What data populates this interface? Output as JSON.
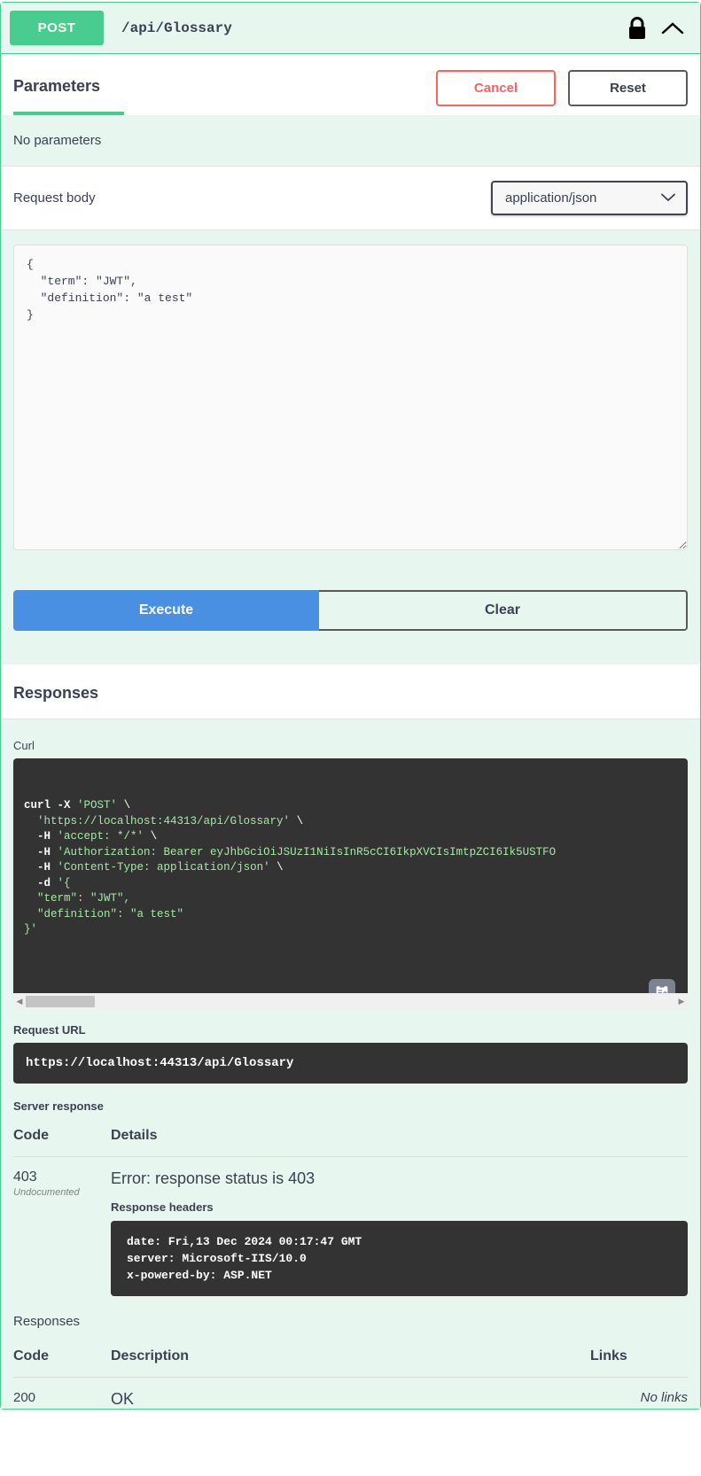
{
  "operation": {
    "method": "POST",
    "path": "/api/Glossary",
    "lock_icon": "lock-icon",
    "collapse_icon": "chevron-up-icon"
  },
  "parameters": {
    "title": "Parameters",
    "cancel_label": "Cancel",
    "reset_label": "Reset",
    "empty_text": "No parameters"
  },
  "request_body": {
    "label": "Request body",
    "content_type": "application/json",
    "content_type_options": [
      "application/json"
    ],
    "dropdown_icon": "chevron-down-icon",
    "editor_value": "{\n  \"term\": \"JWT\",\n  \"definition\": \"a test\"\n}"
  },
  "actions": {
    "execute_label": "Execute",
    "clear_label": "Clear"
  },
  "responses_section": {
    "title": "Responses",
    "curl_label": "Curl",
    "curl_lines": [
      "curl -X 'POST' \\",
      "  'https://localhost:44313/api/Glossary' \\",
      "  -H 'accept: */*' \\",
      "  -H 'Authorization: Bearer eyJhbGciOiJSUzI1NiIsInR5cCI6IkpXVCIsImtpZCI6Ik5USTFO",
      "  -H 'Content-Type: application/json' \\",
      "  -d '{",
      "  \"term\": \"JWT\",",
      "  \"definition\": \"a test\"",
      "}'"
    ],
    "copy_icon": "copy-to-clipboard-icon",
    "scroll_left_icon": "scroll-left-arrow-icon",
    "scroll_right_icon": "scroll-right-arrow-icon",
    "request_url_label": "Request URL",
    "request_url": "https://localhost:44313/api/Glossary",
    "server_response_label": "Server response",
    "server_table": {
      "headers": [
        "Code",
        "Details"
      ],
      "rows": [
        {
          "code": "403",
          "code_note": "Undocumented",
          "details_message": "Error: response status is 403",
          "response_headers_label": "Response headers",
          "response_headers": "date: Fri,13 Dec 2024 00:17:47 GMT\nserver: Microsoft-IIS/10.0\nx-powered-by: ASP.NET"
        }
      ]
    },
    "responses_label": "Responses",
    "responses_table": {
      "headers": [
        "Code",
        "Description",
        "Links"
      ],
      "rows": [
        {
          "code": "200",
          "description": "OK",
          "links": "No links"
        }
      ]
    }
  },
  "colors": {
    "method_green": "#49cc90",
    "panel_green": "#e8f6f0",
    "execute_blue": "#4990e2",
    "cancel_red": "#ff6060",
    "code_dark": "#333333",
    "code_text_green": "#a5e8a5"
  }
}
